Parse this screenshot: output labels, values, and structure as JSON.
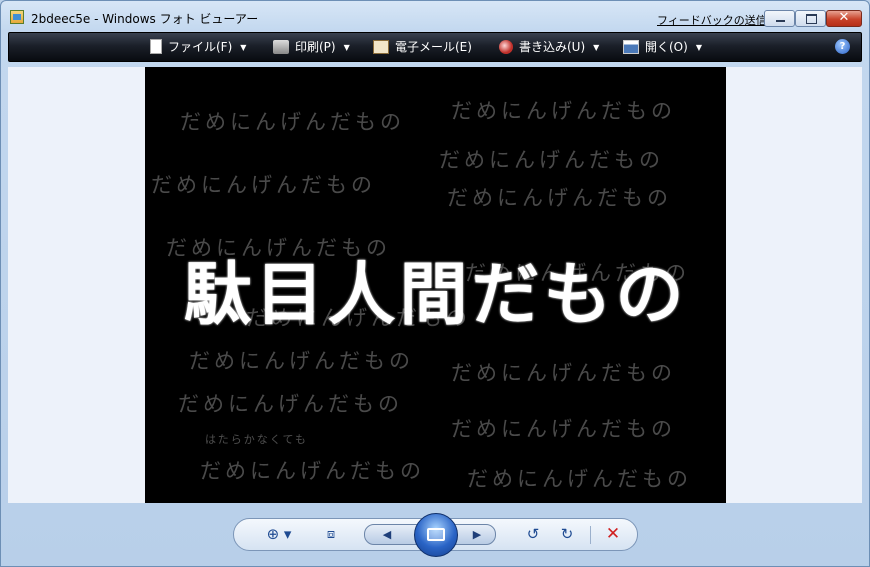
{
  "window": {
    "title": "2bdeec5e - Windows フォト ビューアー",
    "feedback_link": "フィードバックの送信",
    "close_glyph": "✕"
  },
  "menu": {
    "items": [
      {
        "label": "ファイル(F)",
        "icon": "file-icon",
        "has_dropdown": true
      },
      {
        "label": "印刷(P)",
        "icon": "printer-icon",
        "has_dropdown": true
      },
      {
        "label": "電子メール(E)",
        "icon": "email-icon",
        "has_dropdown": false
      },
      {
        "label": "書き込み(U)",
        "icon": "burn-disc-icon",
        "has_dropdown": true
      },
      {
        "label": "開く(O)",
        "icon": "open-icon",
        "has_dropdown": true
      }
    ],
    "caret": "▼",
    "help_glyph": "?"
  },
  "photo": {
    "main_text": "駄目人間だもの",
    "background_phrase": "だめにんげんだもの",
    "small_phrase": "はたらかなくても"
  },
  "controls": {
    "zoom": "⊕ ▾",
    "fit": "⧈",
    "prev": "◀",
    "next": "▶",
    "rotate_ccw": "↺",
    "rotate_cw": "↻",
    "delete": "✕"
  }
}
